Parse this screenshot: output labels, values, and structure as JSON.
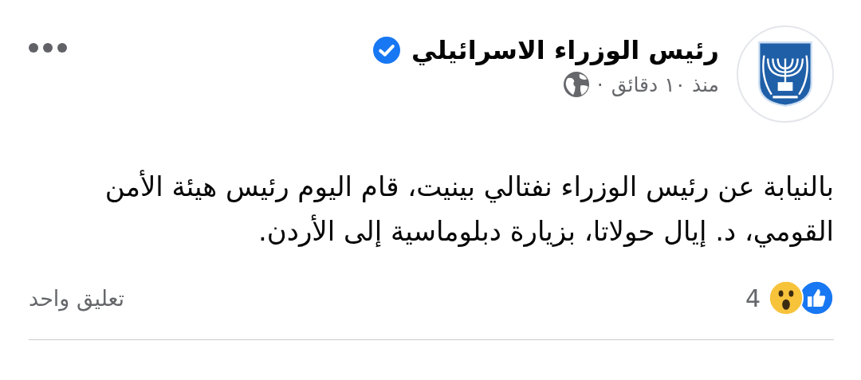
{
  "post": {
    "author": "رئيس الوزراء الاسرائيلي",
    "verified": true,
    "time": "منذ ١٠ دقائق",
    "separator": "·",
    "public": true,
    "text": "بالنيابة عن رئيس الوزراء نفتالي بينيت، قام اليوم رئيس هيئة الأمن القومي، د. إيال حولاتا، بزيارة دبلوماسية إلى الأردن.",
    "reactions": [
      {
        "kind": "like"
      },
      {
        "kind": "wow"
      }
    ],
    "reaction_count": "4",
    "comments": "تعليق واحد"
  }
}
